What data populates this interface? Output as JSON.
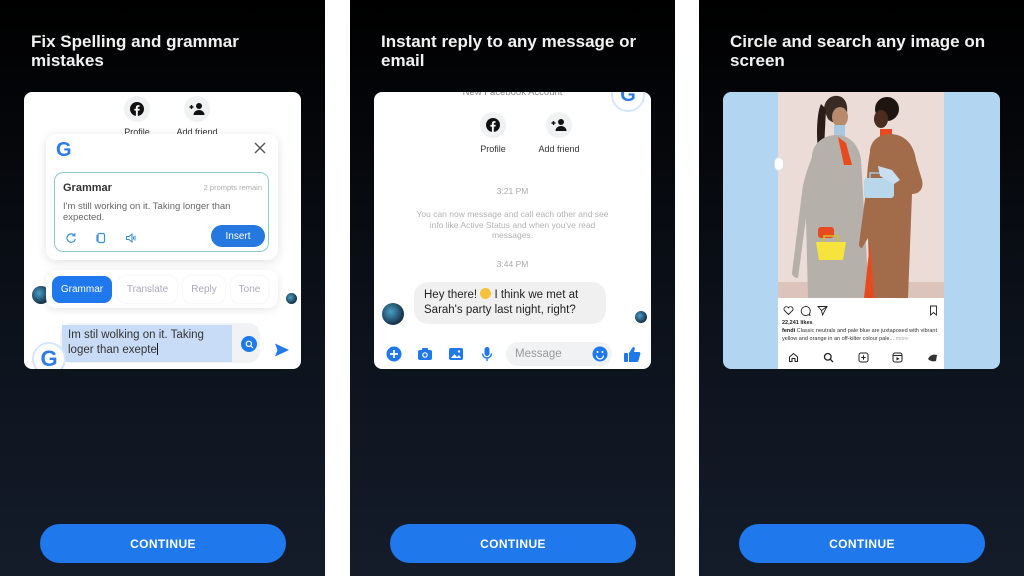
{
  "panels": [
    {
      "title": "Fix Spelling and grammar mistakes",
      "continue_label": "CONTINUE",
      "screen": {
        "fb_actions": [
          {
            "label": "Profile",
            "icon": "facebook-icon"
          },
          {
            "label": "Add friend",
            "icon": "add-friend-icon"
          }
        ],
        "popup": {
          "logo": "G",
          "card_title": "Grammar",
          "prompts_remaining": "2 prompts remain",
          "result_text": "I'm still working on it. Taking longer than expected.",
          "insert_label": "Insert",
          "icons": [
            "refresh-icon",
            "copy-icon",
            "speaker-icon"
          ]
        },
        "chips": [
          {
            "label": "Grammar",
            "active": true
          },
          {
            "label": "Translate",
            "active": false
          },
          {
            "label": "Reply",
            "active": false
          },
          {
            "label": "Tone",
            "active": false
          }
        ],
        "input_text": "Im stil wolking on it. Taking loger than exepte",
        "floating_logo": "G"
      }
    },
    {
      "title": "Instant reply to any message or email",
      "continue_label": "CONTINUE",
      "screen": {
        "header_text": "New Facebook Account",
        "corner_logo": "G",
        "fb_actions": [
          {
            "label": "Profile",
            "icon": "facebook-icon"
          },
          {
            "label": "Add friend",
            "icon": "add-friend-icon"
          }
        ],
        "timestamp_1": "3:21 PM",
        "system_message": "You can now message and call each other and see info like Active Status and when you've read messages.",
        "timestamp_2": "3:44 PM",
        "message_part1": "Hey there! ",
        "message_part2": " I think we met at Sarah's party last night, right?",
        "composer_placeholder": "Message",
        "composer_icons": [
          "plus-icon",
          "camera-icon",
          "gallery-icon",
          "microphone-icon"
        ]
      }
    },
    {
      "title": "Circle and search any image on screen",
      "continue_label": "CONTINUE",
      "screen": {
        "likes": "22,241 likes",
        "caption_user": "fendi",
        "caption_text": " Classic neutrals and pale blue are juxtaposed with vibrant yellow and orange in an off-kilter colour pale...",
        "caption_more": " more",
        "nav_icons": [
          "home-icon",
          "search-icon",
          "create-icon",
          "reels-icon",
          "profile-icon"
        ]
      }
    }
  ],
  "colors": {
    "accent": "#1f78ec",
    "grammarly_blue": "#2d7be5",
    "background_top": "#000000",
    "background_bottom": "#141c2a"
  }
}
